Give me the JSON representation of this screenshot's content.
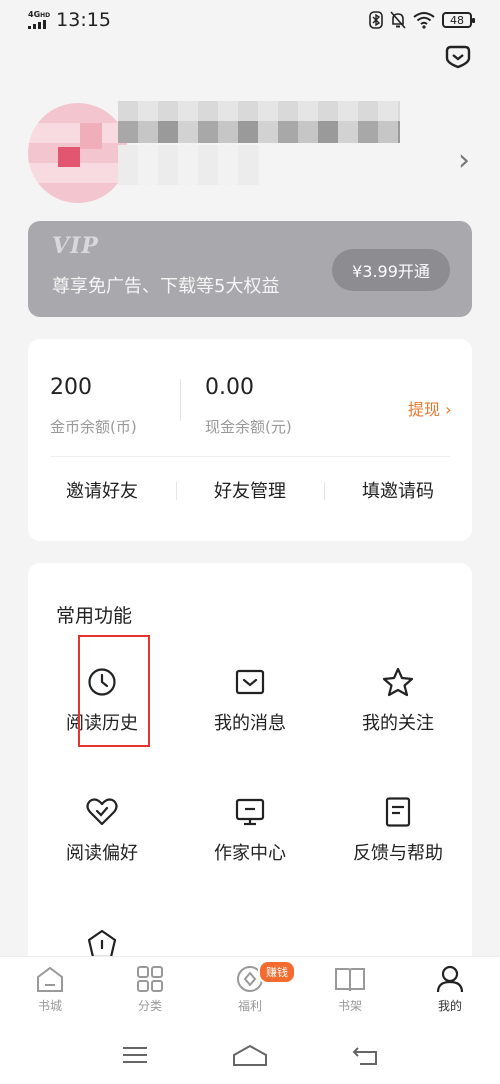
{
  "status_bar": {
    "network": "4G",
    "network_hd": "HD",
    "time": "13:15",
    "battery": "48"
  },
  "profile": {},
  "vip": {
    "logo": "VIP",
    "description": "尊享免广告、下载等5大权益",
    "button": "¥3.99开通"
  },
  "wallet": {
    "coins_value": "200",
    "coins_label": "金币余额(币)",
    "cash_value": "0.00",
    "cash_label": "现金余额(元)",
    "withdraw": "提现 ›",
    "friend_actions": [
      "邀请好友",
      "好友管理",
      "填邀请码"
    ]
  },
  "functions": {
    "title": "常用功能",
    "items": [
      {
        "label": "阅读历史",
        "icon": "clock-icon"
      },
      {
        "label": "我的消息",
        "icon": "message-icon"
      },
      {
        "label": "我的关注",
        "icon": "star-icon"
      },
      {
        "label": "阅读偏好",
        "icon": "heart-icon"
      },
      {
        "label": "作家中心",
        "icon": "monitor-icon"
      },
      {
        "label": "反馈与帮助",
        "icon": "document-icon"
      }
    ]
  },
  "tabs": [
    {
      "label": "书城",
      "icon": "home-icon"
    },
    {
      "label": "分类",
      "icon": "grid-icon"
    },
    {
      "label": "福利",
      "icon": "coin-icon",
      "badge": "赚钱"
    },
    {
      "label": "书架",
      "icon": "book-icon"
    },
    {
      "label": "我的",
      "icon": "user-icon",
      "active": true
    }
  ],
  "colors": {
    "accent": "#e8772e",
    "badge": "#f36b2e",
    "vip_card": "#a9a9ad",
    "highlight": "#e3342f"
  }
}
